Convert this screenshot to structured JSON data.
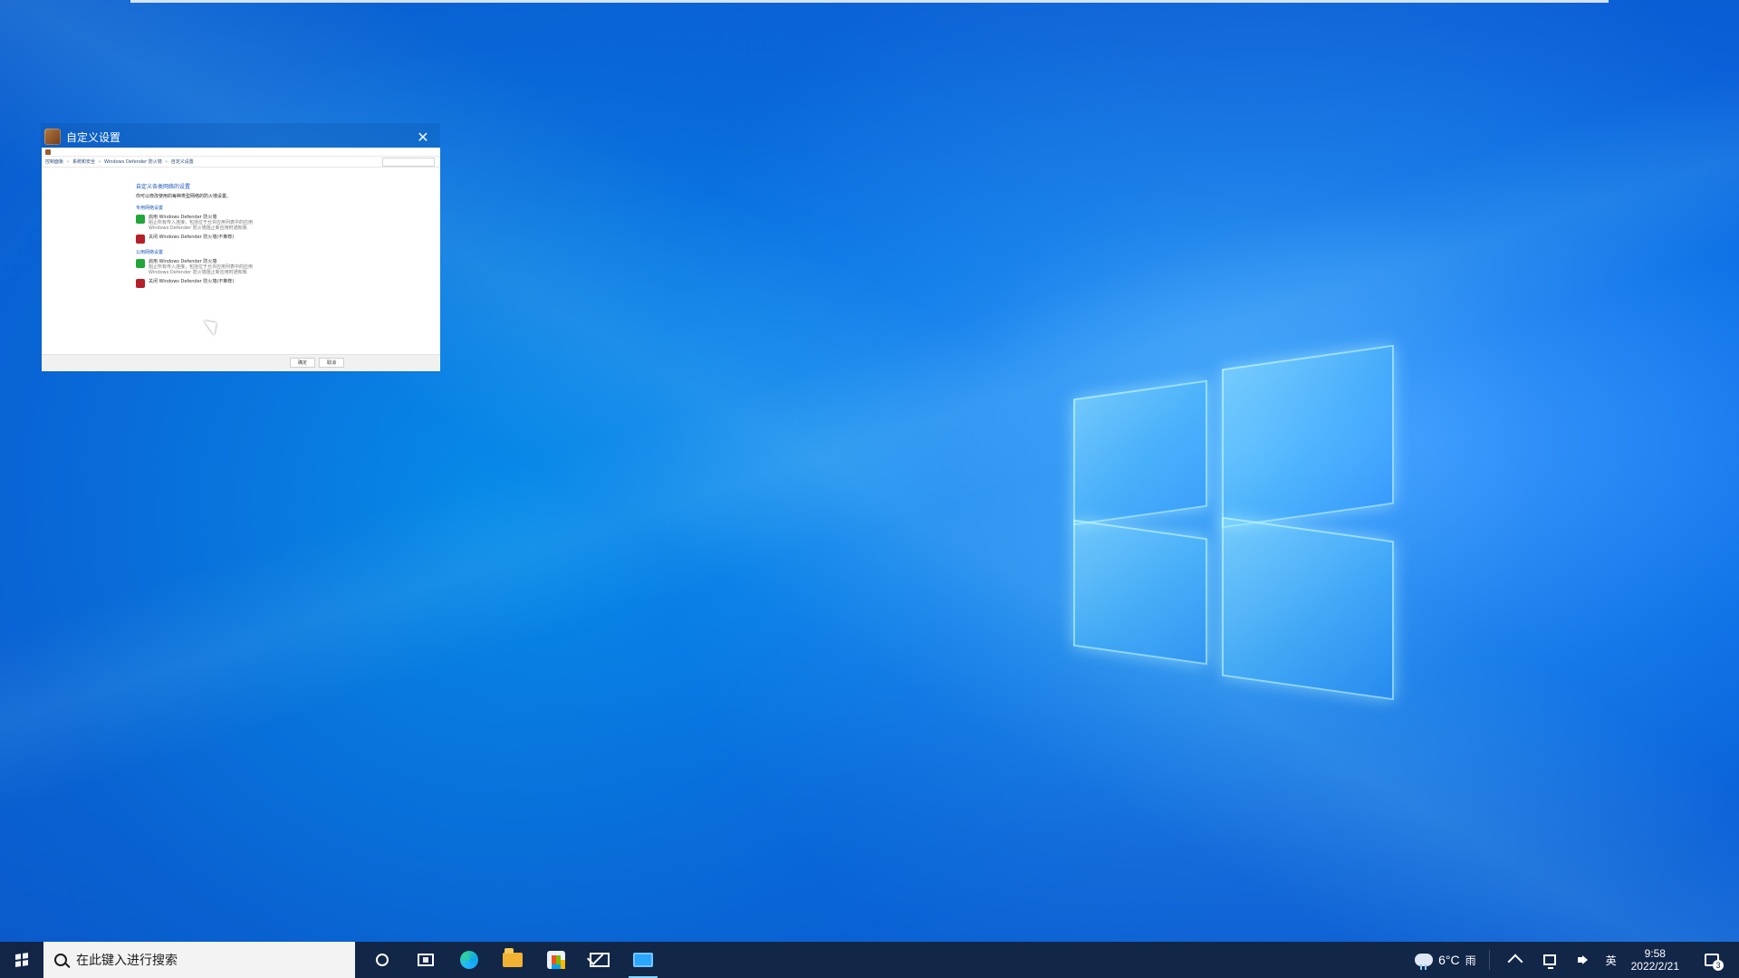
{
  "window": {
    "title": "自定义设置",
    "thumbnail": {
      "address_bar": {
        "breadcrumbs": [
          "控制面板",
          "系统和安全",
          "Windows Defender 防火墙",
          "自定义设置"
        ]
      },
      "heading": "自定义各类网络的设置",
      "subheading": "你可以修改使用的每种类型网络的防火墙设置。",
      "sections": [
        {
          "title": "专用网络设置",
          "options": [
            {
              "label": "启用 Windows Defender 防火墙",
              "sub1": "阻止所有传入连接，包括位于允许应用列表中的应用",
              "sub2": "Windows Defender 防火墙阻止新应用时通知我",
              "shield": "green"
            },
            {
              "label": "关闭 Windows Defender 防火墙(不推荐)",
              "shield": "red"
            }
          ]
        },
        {
          "title": "公用网络设置",
          "options": [
            {
              "label": "启用 Windows Defender 防火墙",
              "sub1": "阻止所有传入连接，包括位于允许应用列表中的应用",
              "sub2": "Windows Defender 防火墙阻止新应用时通知我",
              "shield": "green"
            },
            {
              "label": "关闭 Windows Defender 防火墙(不推荐)",
              "shield": "red"
            }
          ]
        }
      ],
      "footer_buttons": [
        "确定",
        "取消"
      ]
    }
  },
  "taskbar": {
    "search_placeholder": "在此键入进行搜索",
    "tray": {
      "temperature": "6°C",
      "weather": "雨",
      "ime": "英"
    },
    "clock": {
      "time": "9:58",
      "date": "2022/2/21"
    },
    "notifications_count": "3"
  },
  "colors": {
    "accent": "#2aa6ff",
    "taskbar": "#14223c"
  },
  "icons": {
    "close": "close-icon",
    "search": "search-icon",
    "windows": "windows-logo-icon",
    "cortana": "cortana-icon",
    "task_view": "task-view-icon",
    "edge": "edge-icon",
    "file_explorer": "folder-icon",
    "store": "store-icon",
    "mail": "mail-icon",
    "settings_app": "settings-app-icon",
    "weather": "cloud-rain-icon",
    "chevron_up": "chevron-up-icon",
    "network": "network-icon",
    "volume": "speaker-icon",
    "notifications": "notification-icon"
  }
}
